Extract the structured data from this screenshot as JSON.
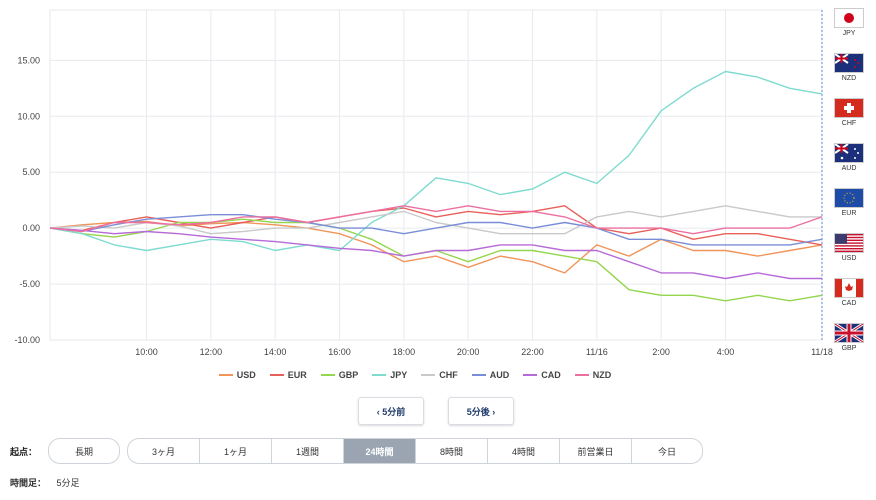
{
  "chart_data": {
    "type": "line",
    "yticks": [
      "15.00",
      "10.00",
      "5.00",
      "0.00",
      "-5.00",
      "-10.00"
    ],
    "ytick_values": [
      15,
      10,
      5,
      0,
      -5,
      -10
    ],
    "ylim": [
      -10,
      19.5
    ],
    "xlim": [
      0,
      24
    ],
    "xticks": [
      "10:00",
      "12:00",
      "14:00",
      "16:00",
      "18:00",
      "20:00",
      "22:00",
      "11/16",
      "2:00",
      "4:00",
      "11/18"
    ],
    "xtick_values": [
      3,
      5,
      7,
      9,
      11,
      13,
      15,
      17,
      19,
      21,
      24
    ],
    "series": [
      {
        "name": "USD",
        "color": "#f0945a",
        "x": [
          0,
          1,
          2,
          3,
          4,
          5,
          6,
          7,
          8,
          9,
          10,
          11,
          12,
          13,
          14,
          15,
          16,
          17,
          18,
          19,
          20,
          21,
          22,
          23,
          24
        ],
        "values": [
          0.0,
          0.3,
          0.5,
          0.6,
          0.2,
          0.4,
          0.5,
          0.3,
          0.0,
          -0.5,
          -1.5,
          -3.0,
          -2.5,
          -3.5,
          -2.5,
          -3.0,
          -4.0,
          -1.5,
          -2.5,
          -1.0,
          -2.0,
          -2.0,
          -2.5,
          -2.0,
          -1.5
        ]
      },
      {
        "name": "EUR",
        "color": "#e8605a",
        "x": [
          0,
          1,
          2,
          3,
          4,
          5,
          6,
          7,
          8,
          9,
          10,
          11,
          12,
          13,
          14,
          15,
          16,
          17,
          18,
          19,
          20,
          21,
          22,
          23,
          24
        ],
        "values": [
          0.0,
          -0.2,
          0.5,
          1.0,
          0.5,
          0.0,
          0.5,
          1.0,
          0.5,
          1.0,
          1.5,
          1.8,
          1.0,
          1.5,
          1.2,
          1.5,
          2.0,
          0.0,
          -0.5,
          0.0,
          -1.0,
          -0.5,
          -0.5,
          -1.0,
          -1.5
        ]
      },
      {
        "name": "GBP",
        "color": "#94d64e",
        "x": [
          0,
          1,
          2,
          3,
          4,
          5,
          6,
          7,
          8,
          9,
          10,
          11,
          12,
          13,
          14,
          15,
          16,
          17,
          18,
          19,
          20,
          21,
          22,
          23,
          24
        ],
        "values": [
          0.0,
          -0.5,
          -0.8,
          -0.3,
          0.5,
          0.5,
          0.8,
          0.5,
          0.5,
          0.0,
          -1.0,
          -2.5,
          -2.0,
          -3.0,
          -2.0,
          -2.0,
          -2.5,
          -3.0,
          -5.5,
          -6.0,
          -6.0,
          -6.5,
          -6.0,
          -6.5,
          -6.0
        ]
      },
      {
        "name": "JPY",
        "color": "#7edbd0",
        "x": [
          0,
          1,
          2,
          3,
          4,
          5,
          6,
          7,
          8,
          9,
          10,
          11,
          12,
          13,
          14,
          15,
          16,
          17,
          18,
          19,
          20,
          21,
          22,
          23,
          24
        ],
        "values": [
          0.0,
          -0.5,
          -1.5,
          -2.0,
          -1.5,
          -1.0,
          -1.2,
          -2.0,
          -1.5,
          -2.0,
          0.5,
          2.0,
          4.5,
          4.0,
          3.0,
          3.5,
          5.0,
          4.0,
          6.5,
          10.5,
          12.5,
          14.0,
          13.5,
          12.5,
          12.0
        ]
      },
      {
        "name": "CHF",
        "color": "#c9c9c9",
        "x": [
          0,
          1,
          2,
          3,
          4,
          5,
          6,
          7,
          8,
          9,
          10,
          11,
          12,
          13,
          14,
          15,
          16,
          17,
          18,
          19,
          20,
          21,
          22,
          23,
          24
        ],
        "values": [
          0.0,
          0.2,
          0.0,
          0.5,
          0.2,
          -0.5,
          -0.3,
          0.0,
          0.0,
          0.5,
          1.0,
          1.5,
          0.5,
          0.0,
          -0.5,
          -0.5,
          -0.5,
          1.0,
          1.5,
          1.0,
          1.5,
          2.0,
          1.5,
          1.0,
          1.0
        ]
      },
      {
        "name": "AUD",
        "color": "#7a8ed8",
        "x": [
          0,
          1,
          2,
          3,
          4,
          5,
          6,
          7,
          8,
          9,
          10,
          11,
          12,
          13,
          14,
          15,
          16,
          17,
          18,
          19,
          20,
          21,
          22,
          23,
          24
        ],
        "values": [
          0.0,
          -0.3,
          0.3,
          0.8,
          1.0,
          1.2,
          1.2,
          0.8,
          0.5,
          0.0,
          0.0,
          -0.5,
          0.0,
          0.5,
          0.5,
          0.0,
          0.5,
          0.0,
          -1.0,
          -1.0,
          -1.5,
          -1.5,
          -1.5,
          -1.5,
          -1.0
        ]
      },
      {
        "name": "CAD",
        "color": "#b66ad8",
        "x": [
          0,
          1,
          2,
          3,
          4,
          5,
          6,
          7,
          8,
          9,
          10,
          11,
          12,
          13,
          14,
          15,
          16,
          17,
          18,
          19,
          20,
          21,
          22,
          23,
          24
        ],
        "values": [
          0.0,
          -0.2,
          -0.5,
          -0.3,
          -0.5,
          -0.8,
          -1.0,
          -1.2,
          -1.5,
          -1.8,
          -2.0,
          -2.5,
          -2.0,
          -2.0,
          -1.5,
          -1.5,
          -2.0,
          -2.0,
          -3.0,
          -4.0,
          -4.0,
          -4.5,
          -4.0,
          -4.5,
          -4.5
        ]
      },
      {
        "name": "NZD",
        "color": "#ec6fa0",
        "x": [
          0,
          1,
          2,
          3,
          4,
          5,
          6,
          7,
          8,
          9,
          10,
          11,
          12,
          13,
          14,
          15,
          16,
          17,
          18,
          19,
          20,
          21,
          22,
          23,
          24
        ],
        "values": [
          0.0,
          -0.3,
          0.5,
          0.5,
          0.3,
          0.5,
          1.0,
          1.0,
          0.5,
          1.0,
          1.5,
          2.0,
          1.5,
          2.0,
          1.5,
          1.5,
          1.0,
          0.0,
          0.0,
          0.0,
          -0.5,
          0.0,
          0.0,
          0.0,
          1.0
        ]
      }
    ]
  },
  "flags": [
    {
      "code": "JPY"
    },
    {
      "code": "NZD"
    },
    {
      "code": "CHF"
    },
    {
      "code": "AUD"
    },
    {
      "code": "EUR"
    },
    {
      "code": "USD"
    },
    {
      "code": "CAD"
    },
    {
      "code": "GBP"
    }
  ],
  "nav": {
    "prev": "‹ 5分前",
    "next": "5分後 ›"
  },
  "start_label": "起点：",
  "long_term": "長期",
  "ranges": [
    "3ヶ月",
    "1ヶ月",
    "1週間",
    "24時間",
    "8時間",
    "4時間",
    "前営業日",
    "今日"
  ],
  "active_range": "24時間",
  "timeframe_label": "時間足：",
  "timeframe_value": "5分足"
}
